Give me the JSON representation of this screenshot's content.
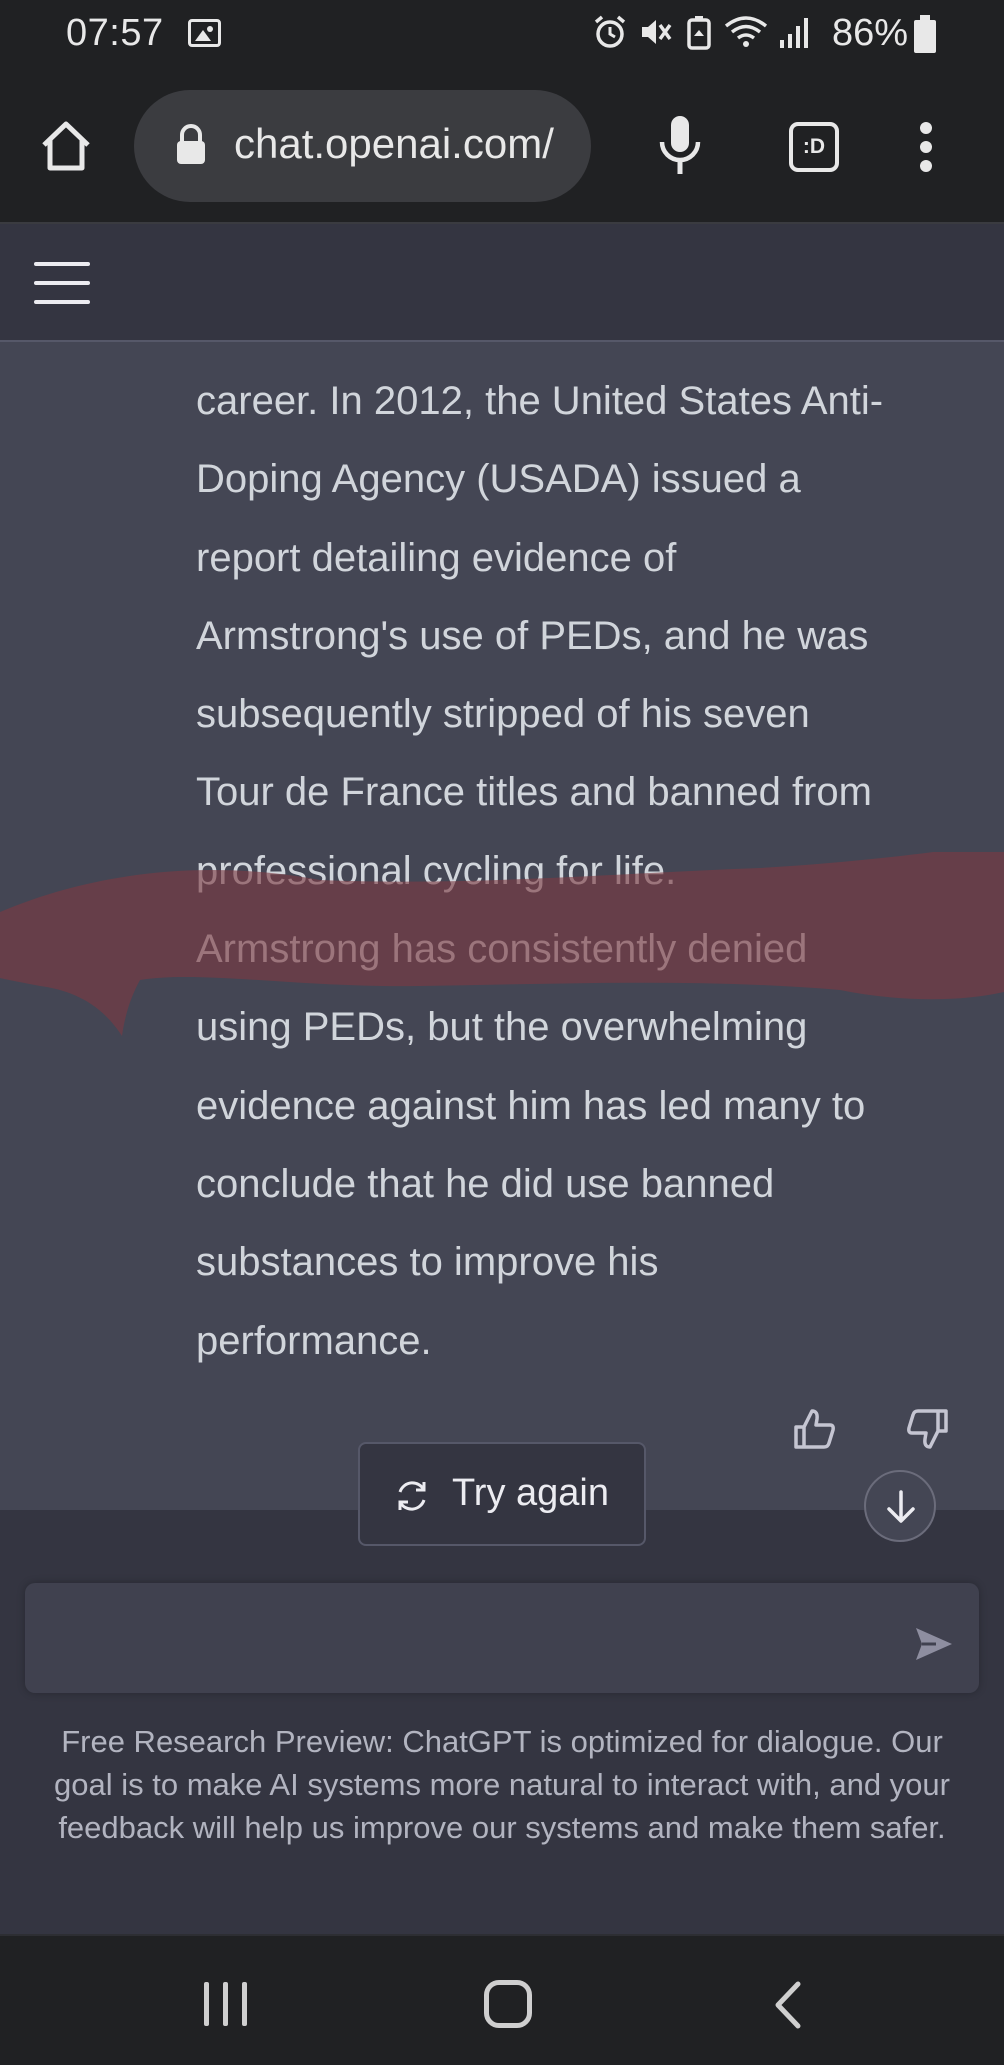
{
  "status_bar": {
    "time": "07:57",
    "battery_percent": "86%",
    "icons": [
      "image-icon",
      "alarm-icon",
      "mute-icon",
      "data-saver-icon",
      "wifi-icon",
      "signal-icon",
      "battery-icon"
    ]
  },
  "browser": {
    "url": "chat.openai.com/",
    "tab_switcher_label": ":D"
  },
  "message": {
    "lines": [
      "career. In 2012, the United States Anti-",
      "Doping Agency (USADA) issued a",
      "report detailing evidence of",
      "Armstrong's use of PEDs, and he was",
      "subsequently stripped of his seven",
      "Tour de France titles and banned from",
      "professional cycling for life.",
      "Armstrong has consistently denied",
      "using PEDs, but the overwhelming",
      "evidence against him has led many to",
      "conclude that he did use banned",
      "substances to improve his",
      "performance."
    ]
  },
  "actions": {
    "try_again_label": "Try again"
  },
  "composer": {
    "placeholder": ""
  },
  "disclaimer": "Free Research Preview: ChatGPT is optimized for dialogue. Our goal is to make AI systems more natural to interact with, and your feedback will help us improve our systems and make them safer.",
  "colors": {
    "chat_background": "#444654",
    "header_background": "#343541",
    "text": "#d1d5db",
    "highlight_stroke": "#7a3a42"
  }
}
